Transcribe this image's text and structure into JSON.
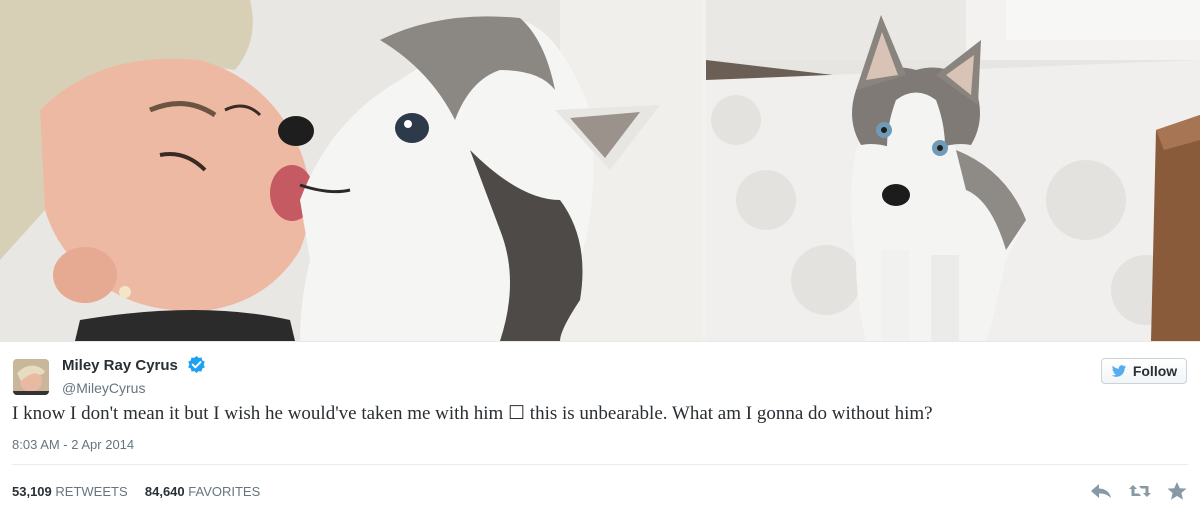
{
  "photos": {
    "left_alt": "",
    "right_alt": ""
  },
  "tweet": {
    "author_name": "Miley Ray Cyrus",
    "handle": "@MileyCyrus",
    "verified_icon": "verified-badge-icon",
    "follow_label": "Follow",
    "text": "I know I don't mean it but I wish he would've taken me with him ☐ this is unbearable. What am I gonna do without him?",
    "timestamp": "8:03 AM - 2 Apr 2014",
    "retweets_count": "53,109",
    "retweets_label": "RETWEETS",
    "favorites_count": "84,640",
    "favorites_label": "FAVORITES",
    "actions": [
      "reply-icon",
      "retweet-icon",
      "favorite-icon"
    ]
  },
  "colors": {
    "twitter_blue": "#55acee",
    "verified_blue": "#1da1f2",
    "text_dark": "#292f33",
    "text_muted": "#66757f"
  }
}
